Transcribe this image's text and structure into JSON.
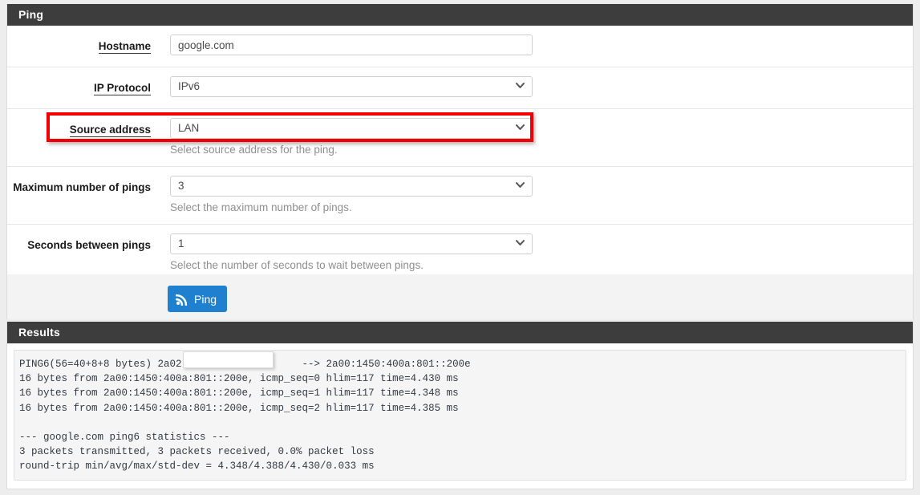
{
  "form_panel": {
    "title": "Ping",
    "rows": [
      {
        "label": "Hostname",
        "underlined": true,
        "control": "text",
        "value": "google.com",
        "placeholder": "",
        "help": ""
      },
      {
        "label": "IP Protocol",
        "underlined": true,
        "control": "select",
        "value": "IPv6",
        "help": ""
      },
      {
        "label": "Source address",
        "underlined": true,
        "control": "select",
        "value": "LAN",
        "help": "Select source address for the ping."
      },
      {
        "label": "Maximum number of pings",
        "underlined": false,
        "control": "select",
        "value": "3",
        "help": "Select the maximum number of pings."
      },
      {
        "label": "Seconds between pings",
        "underlined": false,
        "control": "select",
        "value": "1",
        "help": "Select the number of seconds to wait between pings."
      }
    ]
  },
  "action_bar": {
    "ping_button_label": "Ping",
    "ping_button_icon": "rss-signal-icon",
    "ping_button_color": "#2080d0"
  },
  "highlight": {
    "color": "#f00000",
    "target": "source-address-row"
  },
  "results_panel": {
    "title": "Results",
    "output": "PING6(56=40+8+8 bytes) 2a02:12                 --> 2a00:1450:400a:801::200e\n16 bytes from 2a00:1450:400a:801::200e, icmp_seq=0 hlim=117 time=4.430 ms\n16 bytes from 2a00:1450:400a:801::200e, icmp_seq=1 hlim=117 time=4.348 ms\n16 bytes from 2a00:1450:400a:801::200e, icmp_seq=2 hlim=117 time=4.385 ms\n\n--- google.com ping6 statistics ---\n3 packets transmitted, 3 packets received, 0.0% packet loss\nround-trip min/avg/max/std-dev = 4.348/4.388/4.430/0.033 ms",
    "redacted_region": "source-ipv6-address"
  },
  "icons": {
    "chevron_down": "⌄"
  }
}
